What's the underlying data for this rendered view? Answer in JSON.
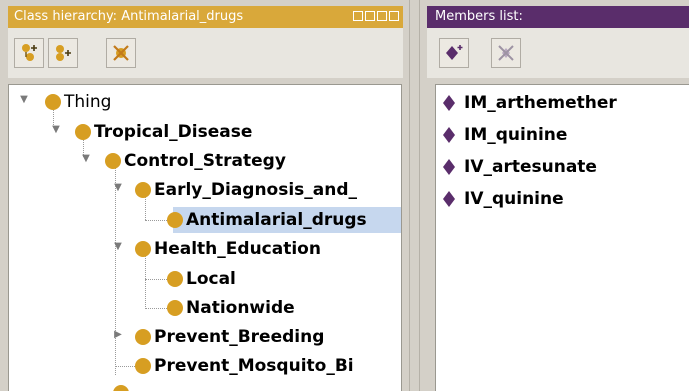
{
  "class_panel": {
    "title": "Class hierarchy: Antimalarial_drugs",
    "toolbar": [
      {
        "name": "add-subclass-button",
        "icon": "add-subclass-icon"
      },
      {
        "name": "add-sibling-button",
        "icon": "add-sibling-icon"
      },
      {
        "name": "delete-class-button",
        "icon": "delete-class-icon"
      }
    ],
    "tree": [
      {
        "label": "Thing",
        "level": 0,
        "expanded": true,
        "bold": false
      },
      {
        "label": "Tropical_Disease",
        "level": 1,
        "expanded": true,
        "bold": true
      },
      {
        "label": "Control_Strategy",
        "level": 2,
        "expanded": true,
        "bold": true
      },
      {
        "label": "Early_Diagnosis_and_",
        "level": 3,
        "expanded": true,
        "bold": true
      },
      {
        "label": "Antimalarial_drugs",
        "level": 4,
        "selected": true,
        "bold": true
      },
      {
        "label": "Health_Education",
        "level": 3,
        "expanded": true,
        "bold": true
      },
      {
        "label": "Local",
        "level": 4,
        "bold": true
      },
      {
        "label": "Nationwide",
        "level": 4,
        "bold": true
      },
      {
        "label": "Prevent_Breeding",
        "level": 3,
        "expanded": false,
        "bold": true
      },
      {
        "label": "Prevent_Mosquito_Bi",
        "level": 3,
        "bold": true
      }
    ]
  },
  "members_panel": {
    "title": "Members list:",
    "toolbar": [
      {
        "name": "add-member-button",
        "icon": "add-individual-icon"
      },
      {
        "name": "delete-member-button",
        "icon": "delete-individual-icon"
      }
    ],
    "members": [
      "IM_arthemether",
      "IM_quinine",
      "IV_artesunate",
      "IV_quinine"
    ]
  },
  "colors": {
    "class_title_bg": "#d9a83a",
    "members_title_bg": "#5a2d6b",
    "class_ball": "#d79e22",
    "individual_diamond": "#5a2d6b",
    "selection": "#c6d7ee"
  }
}
